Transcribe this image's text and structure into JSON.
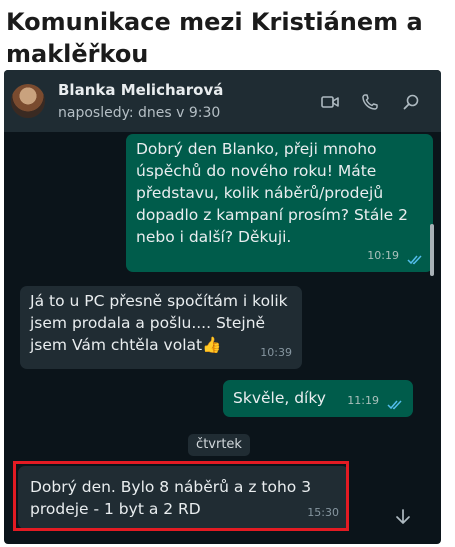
{
  "page_title": "Komunikace mezi Kristiánem a maklěřkou",
  "header": {
    "contact_name": "Blanka Melicharová",
    "status": "naposledy: dnes v 9:30",
    "icons": [
      "video-call-icon",
      "phone-icon",
      "search-icon"
    ]
  },
  "messages": [
    {
      "direction": "outgoing",
      "text": "Dobrý den Blanko, přeji mnoho úspěchů do nového roku! Máte představu, kolik náběrů/prodejů dopadlo z kampaní prosím? Stále 2 nebo i další? Děkuji.",
      "time": "10:19",
      "read": true
    },
    {
      "direction": "incoming",
      "text": "Já to u PC přesně spočítám i kolik jsem prodala a pošlu.... Stejně jsem Vám chtěla volat👍",
      "time": "10:39"
    },
    {
      "direction": "outgoing",
      "text": "Skvěle, díky",
      "time": "11:19",
      "read": true
    },
    {
      "direction": "incoming",
      "text": "Dobrý den. Bylo 8 náběrů a z toho 3 prodeje - 1 byt a 2 RD",
      "time": "15:30",
      "highlighted": true
    }
  ],
  "day_separator": "čtvrtek",
  "colors": {
    "chat_background": "#0b141a",
    "header_background": "#1f2c33",
    "outgoing_bubble": "#005c4b",
    "incoming_bubble": "#202c33",
    "read_ticks": "#53bdeb",
    "highlight_frame": "#e31b23"
  }
}
